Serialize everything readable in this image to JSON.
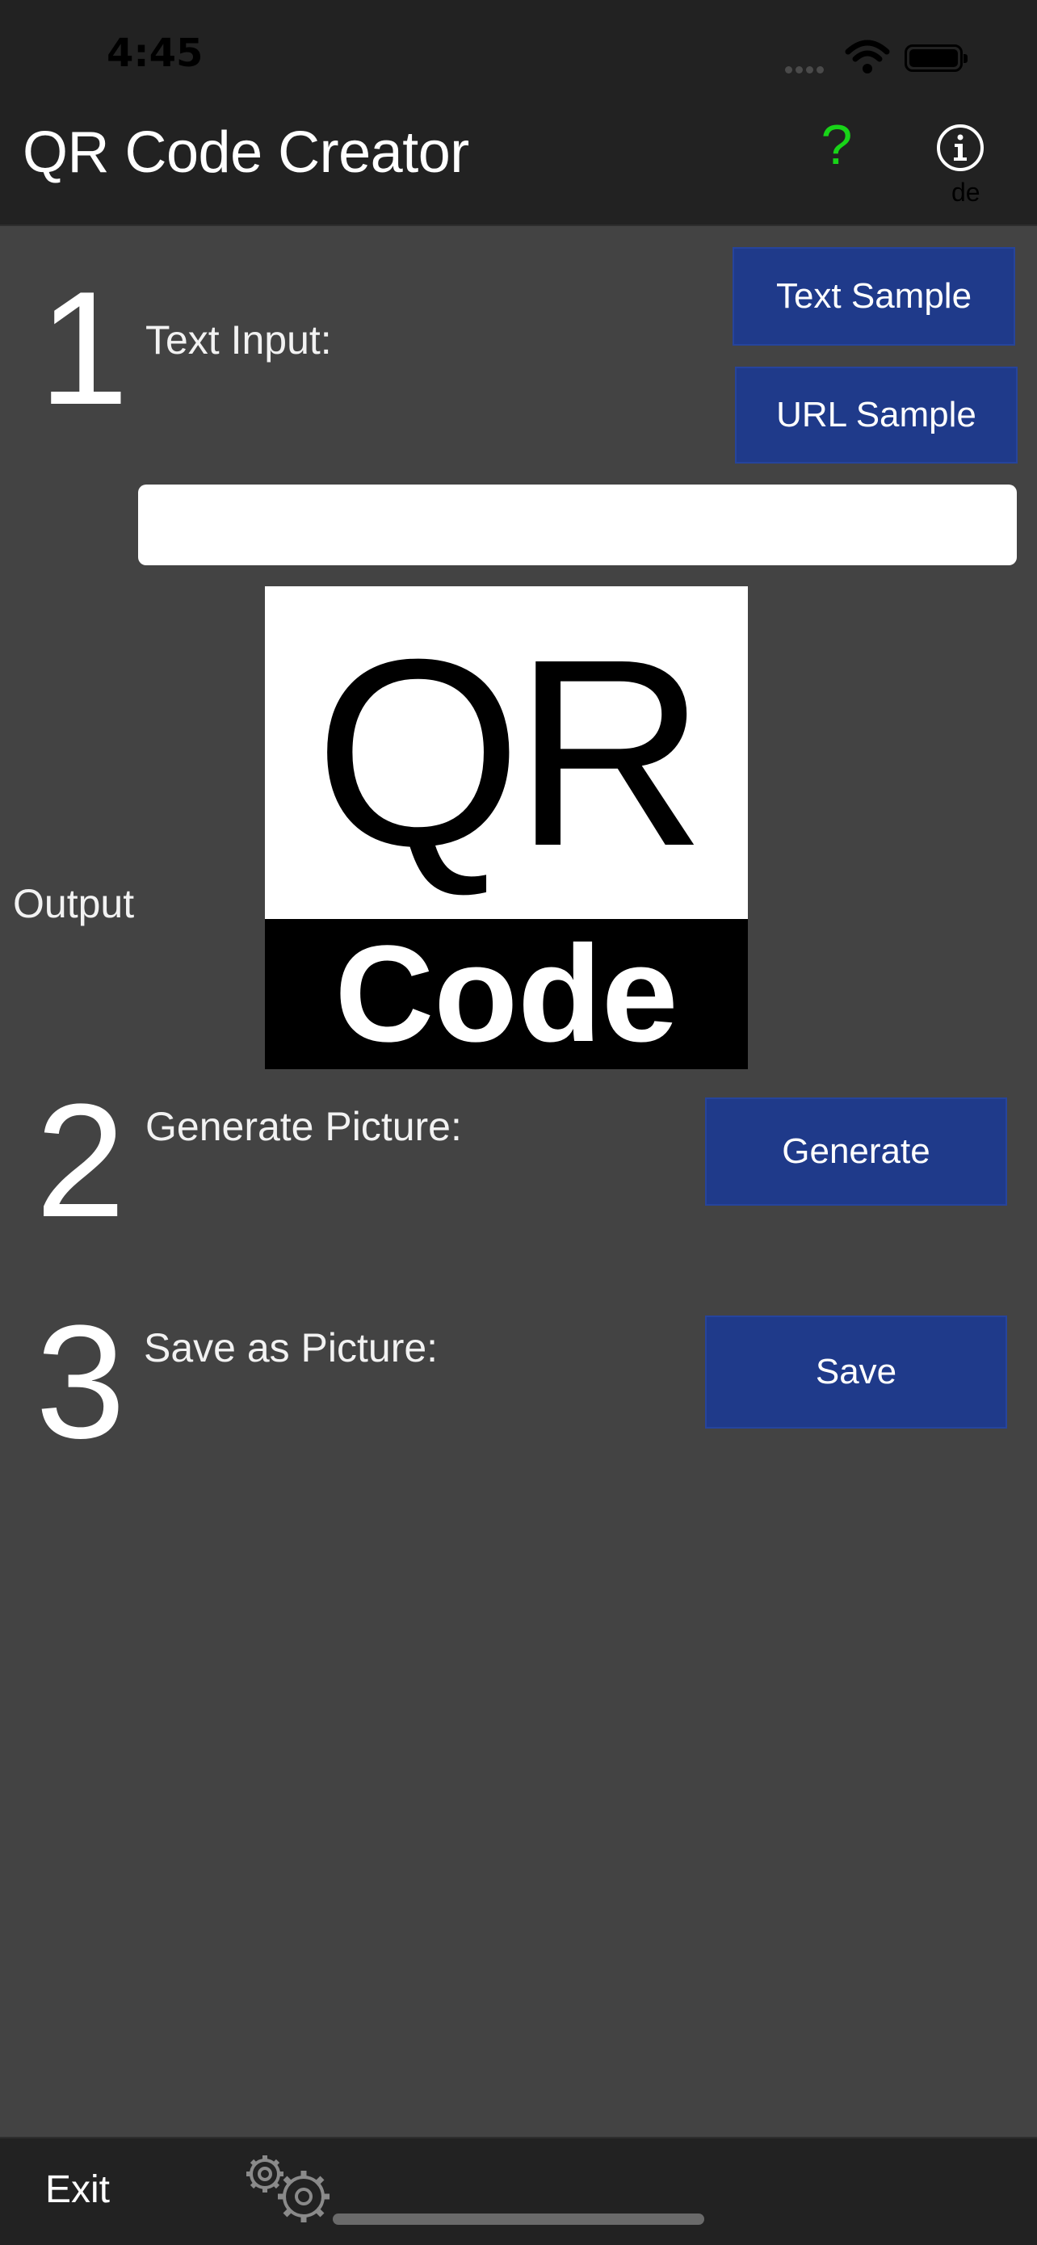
{
  "status_bar": {
    "time": "4:45"
  },
  "nav": {
    "title": "QR Code Creator",
    "help_label": "?",
    "language": "de",
    "help_color": "#18d418"
  },
  "step1": {
    "number": "1",
    "label": "Text Input:",
    "text_sample_label": "Text Sample",
    "url_sample_label": "URL Sample",
    "input_value": ""
  },
  "output": {
    "label": "Output",
    "preview_top": "QR",
    "preview_bottom": "Code"
  },
  "step2": {
    "number": "2",
    "label": "Generate Picture:",
    "button_label": "Generate"
  },
  "step3": {
    "number": "3",
    "label": "Save as Picture:",
    "button_label": "Save"
  },
  "toolbar": {
    "exit_label": "Exit",
    "settings_icon": "gears-icon"
  },
  "colors": {
    "background": "#434343",
    "bar": "#222222",
    "button": "#1f3a8a"
  }
}
